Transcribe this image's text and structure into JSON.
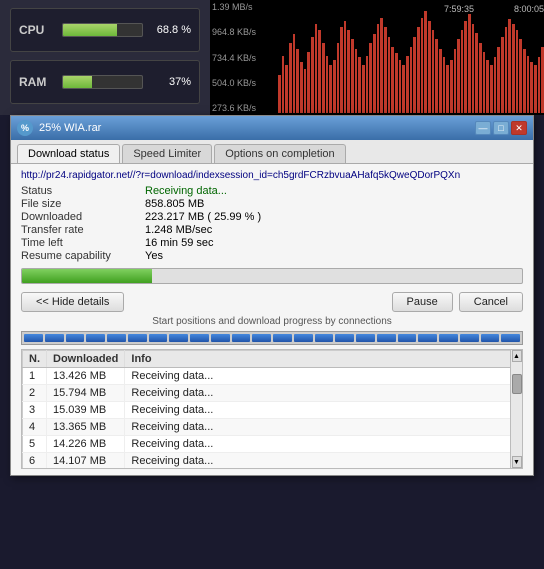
{
  "top_bar": {
    "cpu_label": "CPU",
    "cpu_value": "68.8 %",
    "cpu_percent": 68.8,
    "ram_label": "RAM",
    "ram_value": "37%",
    "ram_percent": 37,
    "chart": {
      "time_labels": [
        "7:59:35",
        "8:00:05"
      ],
      "speed_labels": [
        "1.39 MB/s",
        "964.8 KB/s",
        "734.4 KB/s",
        "504.0 KB/s",
        "273.6 KB/s"
      ],
      "bars": [
        30,
        45,
        38,
        55,
        62,
        50,
        40,
        35,
        48,
        60,
        70,
        65,
        55,
        45,
        38,
        42,
        55,
        68,
        72,
        65,
        58,
        50,
        44,
        38,
        45,
        55,
        62,
        70,
        75,
        68,
        60,
        52,
        47,
        42,
        38,
        45,
        52,
        60,
        68,
        75,
        80,
        72,
        65,
        58,
        50,
        44,
        38,
        42,
        50,
        58,
        65,
        72,
        78,
        70,
        63,
        55,
        48,
        42,
        38,
        44,
        52,
        60,
        68,
        74,
        70,
        65,
        58,
        50,
        45,
        40,
        38,
        44,
        52
      ]
    }
  },
  "window": {
    "title": "25% WIA.rar",
    "icon": "%",
    "controls": {
      "minimize": "—",
      "maximize": "□",
      "close": "✕"
    }
  },
  "tabs": [
    {
      "label": "Download status",
      "active": true
    },
    {
      "label": "Speed Limiter",
      "active": false
    },
    {
      "label": "Options on completion",
      "active": false
    }
  ],
  "download": {
    "url": "http://pr24.rapidgator.net//?r=download/indexsession_id=ch5grdFCRzbvuaAHafq5kQweQDorPQXn",
    "status_label": "Status",
    "status_value": "Receiving data...",
    "file_size_label": "File size",
    "file_size_value": "858.805  MB",
    "downloaded_label": "Downloaded",
    "downloaded_value": "223.217  MB ( 25.99 % )",
    "transfer_rate_label": "Transfer rate",
    "transfer_rate_value": "1.248  MB/sec",
    "time_left_label": "Time left",
    "time_left_value": "16 min 59 sec",
    "resume_label": "Resume capability",
    "resume_value": "Yes",
    "progress_percent": 26,
    "hide_details_btn": "<< Hide details",
    "pause_btn": "Pause",
    "cancel_btn": "Cancel",
    "hint_text": "Start positions and download progress by connections",
    "table": {
      "headers": [
        "N.",
        "Downloaded",
        "Info"
      ],
      "rows": [
        {
          "n": "1",
          "downloaded": "13.426  MB",
          "info": "Receiving data..."
        },
        {
          "n": "2",
          "downloaded": "15.794  MB",
          "info": "Receiving data..."
        },
        {
          "n": "3",
          "downloaded": "15.039  MB",
          "info": "Receiving data..."
        },
        {
          "n": "4",
          "downloaded": "13.365  MB",
          "info": "Receiving data..."
        },
        {
          "n": "5",
          "downloaded": "14.226  MB",
          "info": "Receiving data..."
        },
        {
          "n": "6",
          "downloaded": "14.107  MB",
          "info": "Receiving data..."
        }
      ]
    }
  }
}
